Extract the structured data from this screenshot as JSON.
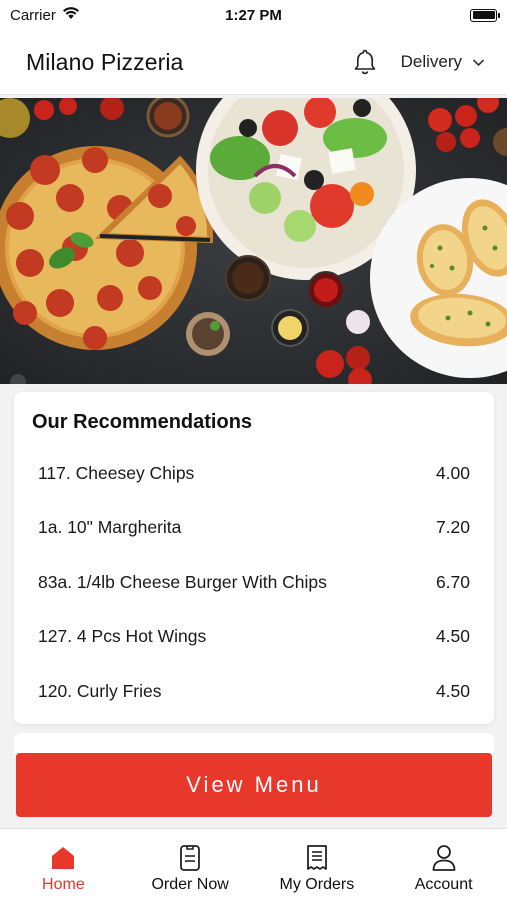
{
  "status_bar": {
    "carrier": "Carrier",
    "time": "1:27 PM"
  },
  "header": {
    "title": "Milano Pizzeria",
    "delivery_label": "Delivery",
    "icons": [
      "bell-icon",
      "chevron-down-icon"
    ]
  },
  "hero": {
    "icon": "food-banner-image"
  },
  "recommendations": {
    "title": "Our Recommendations",
    "items": [
      {
        "name": "117. Cheesey Chips",
        "price": "4.00"
      },
      {
        "name": "1a. 10\" Margherita",
        "price": "7.20"
      },
      {
        "name": "83a. 1/4lb Cheese Burger With Chips",
        "price": "6.70"
      },
      {
        "name": "127. 4 Pcs Hot Wings",
        "price": "4.50"
      },
      {
        "name": "120. Curly Fries",
        "price": "4.50"
      }
    ]
  },
  "view_menu": {
    "label": "View Menu"
  },
  "tabs": [
    {
      "label": "Home",
      "icon": "home-icon",
      "active": true
    },
    {
      "label": "Order Now",
      "icon": "order-sheet-icon",
      "active": false
    },
    {
      "label": "My Orders",
      "icon": "receipt-icon",
      "active": false
    },
    {
      "label": "Account",
      "icon": "person-icon",
      "active": false
    }
  ],
  "colors": {
    "accent": "#e8372b",
    "text": "#111111",
    "background": "#f2f2f2"
  }
}
